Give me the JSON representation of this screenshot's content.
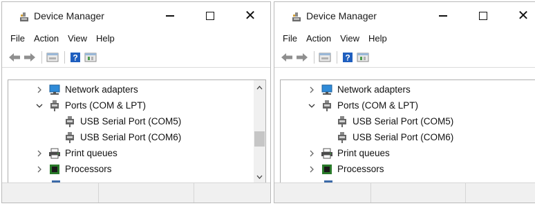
{
  "windows": [
    {
      "title": "Device Manager",
      "menu": [
        "File",
        "Action",
        "View",
        "Help"
      ],
      "tree": {
        "network_adapters": "Network adapters",
        "ports": "Ports (COM & LPT)",
        "com5": "USB Serial Port (COM5)",
        "com6": "USB Serial Port (COM6)",
        "print_queues": "Print queues",
        "processors": "Processors"
      }
    },
    {
      "title": "Device Manager",
      "menu": [
        "File",
        "Action",
        "View",
        "Help"
      ],
      "tree": {
        "network_adapters": "Network adapters",
        "ports": "Ports (COM & LPT)",
        "com5": "USB Serial Port (COM5)",
        "com6": "USB Serial Port (COM6)",
        "print_queues": "Print queues",
        "processors": "Processors"
      }
    }
  ],
  "icons": {
    "app": "device-manager-icon",
    "back": "back-arrow-icon",
    "forward": "forward-arrow-icon",
    "properties": "properties-icon",
    "help": "help-icon",
    "update": "update-driver-icon",
    "network": "network-adapter-icon",
    "port": "port-connector-icon",
    "printer": "printer-icon",
    "processor": "processor-chip-icon"
  },
  "colors": {
    "help_icon": "#1f5fbf",
    "network_icon": "#2f8bd8",
    "processor_icon": "#2a7a2a"
  }
}
